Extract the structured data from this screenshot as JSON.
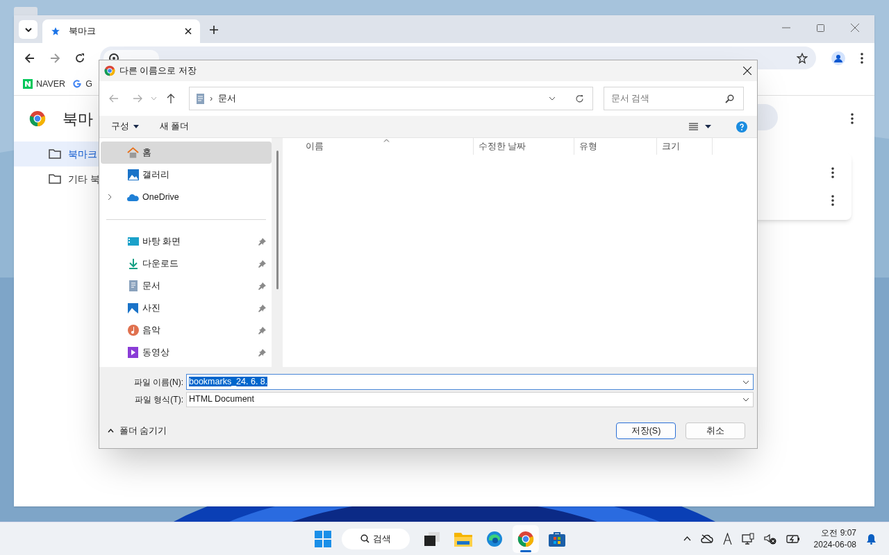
{
  "browser": {
    "tabs": [
      {
        "label": "북마크",
        "selected": true
      }
    ],
    "bookmarks_bar": [
      {
        "label": "NAVER"
      },
      {
        "label": "G"
      }
    ],
    "page_title": "북마",
    "sidebar": [
      {
        "label": "북마크",
        "selected": true
      },
      {
        "label": "기타 북",
        "selected": false
      }
    ]
  },
  "dialog": {
    "title": "다른 이름으로 저장",
    "breadcrumb_separator": "›",
    "breadcrumb": "문서",
    "search_placeholder": "문서 검색",
    "toolbar": [
      "구성",
      "새 폴더"
    ],
    "nav": [
      {
        "label": "홈",
        "selected": true,
        "pinned": false,
        "expandable": false,
        "divider_before": false
      },
      {
        "label": "갤러리",
        "selected": false,
        "pinned": false,
        "expandable": false,
        "divider_before": false
      },
      {
        "label": "OneDrive",
        "selected": false,
        "pinned": false,
        "expandable": true,
        "divider_before": false
      },
      {
        "label": "바탕 화면",
        "selected": false,
        "pinned": true,
        "expandable": false,
        "divider_before": true
      },
      {
        "label": "다운로드",
        "selected": false,
        "pinned": true,
        "expandable": false,
        "divider_before": false
      },
      {
        "label": "문서",
        "selected": false,
        "pinned": true,
        "expandable": false,
        "divider_before": false
      },
      {
        "label": "사진",
        "selected": false,
        "pinned": true,
        "expandable": false,
        "divider_before": false
      },
      {
        "label": "음악",
        "selected": false,
        "pinned": true,
        "expandable": false,
        "divider_before": false
      },
      {
        "label": "동영상",
        "selected": false,
        "pinned": true,
        "expandable": false,
        "divider_before": false
      }
    ],
    "columns": [
      "이름",
      "수정한 날짜",
      "유형",
      "크기"
    ],
    "file_name_label": "파일 이름(N):",
    "file_name": "bookmarks_24. 6. 8.",
    "file_type_label": "파일 형식(T):",
    "file_type": "HTML Document",
    "hide_folders": "폴더 숨기기",
    "buttons": [
      {
        "label": "저장(S)",
        "primary": true
      },
      {
        "label": "취소",
        "primary": false
      }
    ]
  },
  "taskbar": {
    "search": "검색",
    "apps": [
      {
        "selected": false
      },
      {
        "selected": false
      },
      {
        "selected": false
      },
      {
        "selected": true
      },
      {
        "selected": false
      }
    ],
    "time": "오전 9:07",
    "date": "2024-06-08"
  }
}
